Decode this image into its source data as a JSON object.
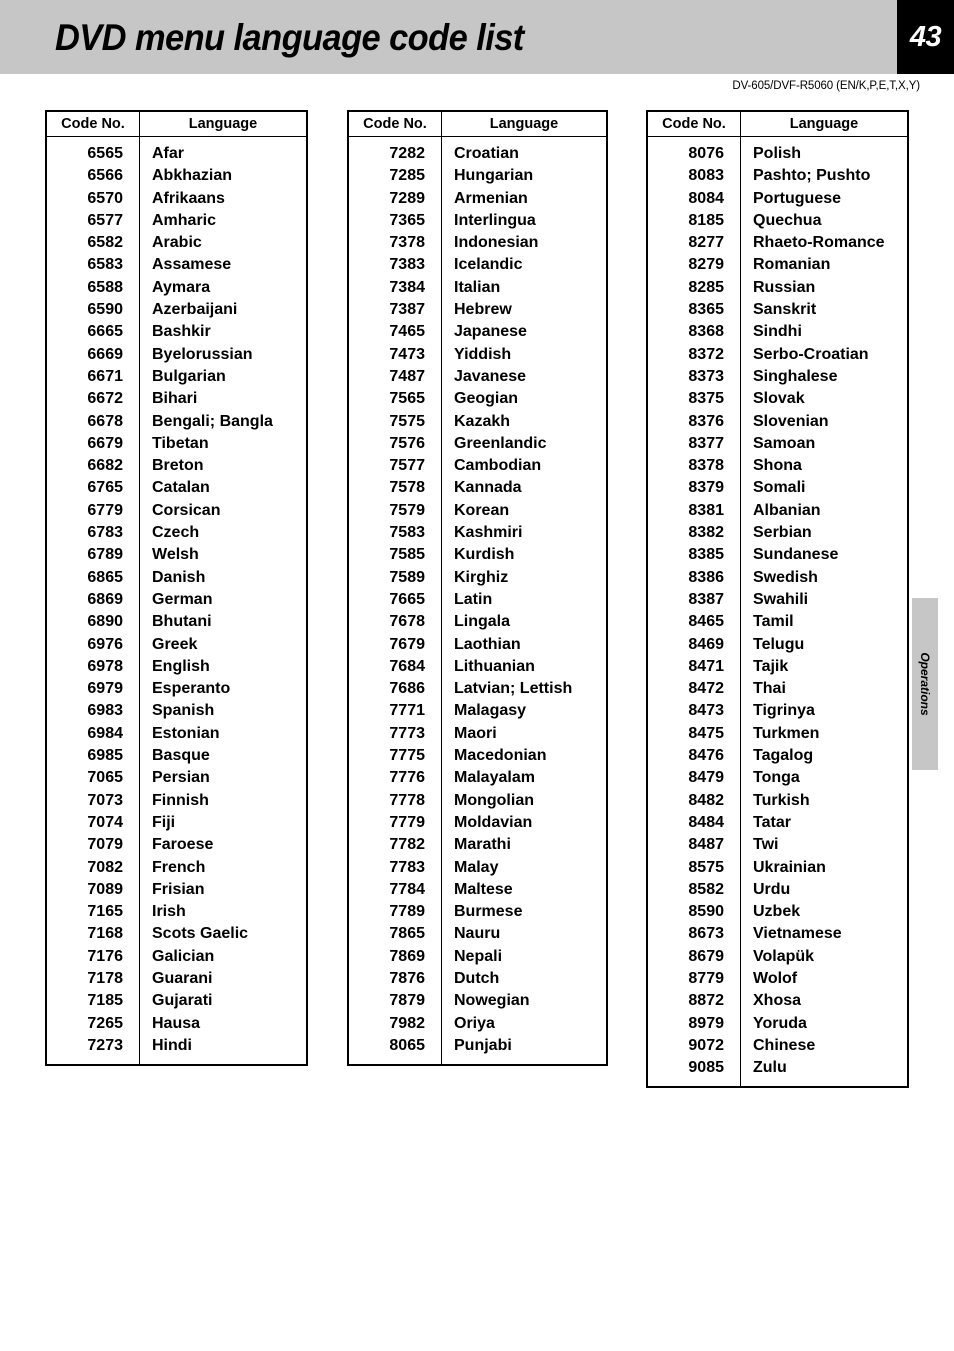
{
  "header": {
    "title": "DVD menu language code list",
    "page_number": "43",
    "model_line": "DV-605/DVF-R5060 (EN/K,P,E,T,X,Y)"
  },
  "side_tab": {
    "label": "Operations"
  },
  "colors": {
    "header_band": "#c6c6c6",
    "page_number_bg": "#000000",
    "page_number_fg": "#ffffff",
    "table_border": "#000000",
    "side_tab_bg": "#c6c6c6"
  },
  "table_columns": [
    "Code No.",
    "Language"
  ],
  "tables": [
    {
      "name": "language-code-table-1",
      "headers": [
        "Code No.",
        "Language"
      ],
      "rows": [
        [
          "6565",
          "Afar"
        ],
        [
          "6566",
          "Abkhazian"
        ],
        [
          "6570",
          "Afrikaans"
        ],
        [
          "6577",
          "Amharic"
        ],
        [
          "6582",
          "Arabic"
        ],
        [
          "6583",
          "Assamese"
        ],
        [
          "6588",
          "Aymara"
        ],
        [
          "6590",
          "Azerbaijani"
        ],
        [
          "6665",
          "Bashkir"
        ],
        [
          "6669",
          "Byelorussian"
        ],
        [
          "6671",
          "Bulgarian"
        ],
        [
          "6672",
          "Bihari"
        ],
        [
          "6678",
          "Bengali; Bangla"
        ],
        [
          "6679",
          "Tibetan"
        ],
        [
          "6682",
          "Breton"
        ],
        [
          "6765",
          "Catalan"
        ],
        [
          "6779",
          "Corsican"
        ],
        [
          "6783",
          "Czech"
        ],
        [
          "6789",
          "Welsh"
        ],
        [
          "6865",
          "Danish"
        ],
        [
          "6869",
          "German"
        ],
        [
          "6890",
          "Bhutani"
        ],
        [
          "6976",
          "Greek"
        ],
        [
          "6978",
          "English"
        ],
        [
          "6979",
          "Esperanto"
        ],
        [
          "6983",
          "Spanish"
        ],
        [
          "6984",
          "Estonian"
        ],
        [
          "6985",
          "Basque"
        ],
        [
          "7065",
          "Persian"
        ],
        [
          "7073",
          "Finnish"
        ],
        [
          "7074",
          "Fiji"
        ],
        [
          "7079",
          "Faroese"
        ],
        [
          "7082",
          "French"
        ],
        [
          "7089",
          "Frisian"
        ],
        [
          "7165",
          "Irish"
        ],
        [
          "7168",
          "Scots Gaelic"
        ],
        [
          "7176",
          "Galician"
        ],
        [
          "7178",
          "Guarani"
        ],
        [
          "7185",
          "Gujarati"
        ],
        [
          "7265",
          "Hausa"
        ],
        [
          "7273",
          "Hindi"
        ]
      ]
    },
    {
      "name": "language-code-table-2",
      "headers": [
        "Code No.",
        "Language"
      ],
      "rows": [
        [
          "7282",
          "Croatian"
        ],
        [
          "7285",
          "Hungarian"
        ],
        [
          "7289",
          "Armenian"
        ],
        [
          "7365",
          "Interlingua"
        ],
        [
          "7378",
          "Indonesian"
        ],
        [
          "7383",
          "Icelandic"
        ],
        [
          "7384",
          "Italian"
        ],
        [
          "7387",
          "Hebrew"
        ],
        [
          "7465",
          "Japanese"
        ],
        [
          "7473",
          "Yiddish"
        ],
        [
          "7487",
          "Javanese"
        ],
        [
          "7565",
          "Geogian"
        ],
        [
          "7575",
          "Kazakh"
        ],
        [
          "7576",
          "Greenlandic"
        ],
        [
          "7577",
          "Cambodian"
        ],
        [
          "7578",
          "Kannada"
        ],
        [
          "7579",
          "Korean"
        ],
        [
          "7583",
          "Kashmiri"
        ],
        [
          "7585",
          "Kurdish"
        ],
        [
          "7589",
          "Kirghiz"
        ],
        [
          "7665",
          "Latin"
        ],
        [
          "7678",
          "Lingala"
        ],
        [
          "7679",
          "Laothian"
        ],
        [
          "7684",
          "Lithuanian"
        ],
        [
          "7686",
          "Latvian; Lettish"
        ],
        [
          "7771",
          "Malagasy"
        ],
        [
          "7773",
          "Maori"
        ],
        [
          "7775",
          "Macedonian"
        ],
        [
          "7776",
          "Malayalam"
        ],
        [
          "7778",
          "Mongolian"
        ],
        [
          "7779",
          "Moldavian"
        ],
        [
          "7782",
          "Marathi"
        ],
        [
          "7783",
          "Malay"
        ],
        [
          "7784",
          "Maltese"
        ],
        [
          "7789",
          "Burmese"
        ],
        [
          "7865",
          "Nauru"
        ],
        [
          "7869",
          "Nepali"
        ],
        [
          "7876",
          "Dutch"
        ],
        [
          "7879",
          "Nowegian"
        ],
        [
          "7982",
          "Oriya"
        ],
        [
          "8065",
          "Punjabi"
        ]
      ]
    },
    {
      "name": "language-code-table-3",
      "headers": [
        "Code No.",
        "Language"
      ],
      "rows": [
        [
          "8076",
          "Polish"
        ],
        [
          "8083",
          "Pashto; Pushto"
        ],
        [
          "8084",
          "Portuguese"
        ],
        [
          "8185",
          "Quechua"
        ],
        [
          "8277",
          "Rhaeto-Romance"
        ],
        [
          "8279",
          "Romanian"
        ],
        [
          "8285",
          "Russian"
        ],
        [
          "8365",
          "Sanskrit"
        ],
        [
          "8368",
          "Sindhi"
        ],
        [
          "8372",
          "Serbo-Croatian"
        ],
        [
          "8373",
          "Singhalese"
        ],
        [
          "8375",
          "Slovak"
        ],
        [
          "8376",
          "Slovenian"
        ],
        [
          "8377",
          "Samoan"
        ],
        [
          "8378",
          "Shona"
        ],
        [
          "8379",
          "Somali"
        ],
        [
          "8381",
          "Albanian"
        ],
        [
          "8382",
          "Serbian"
        ],
        [
          "8385",
          "Sundanese"
        ],
        [
          "8386",
          "Swedish"
        ],
        [
          "8387",
          "Swahili"
        ],
        [
          "8465",
          "Tamil"
        ],
        [
          "8469",
          "Telugu"
        ],
        [
          "8471",
          "Tajik"
        ],
        [
          "8472",
          "Thai"
        ],
        [
          "8473",
          "Tigrinya"
        ],
        [
          "8475",
          "Turkmen"
        ],
        [
          "8476",
          "Tagalog"
        ],
        [
          "8479",
          "Tonga"
        ],
        [
          "8482",
          "Turkish"
        ],
        [
          "8484",
          "Tatar"
        ],
        [
          "8487",
          "Twi"
        ],
        [
          "8575",
          "Ukrainian"
        ],
        [
          "8582",
          "Urdu"
        ],
        [
          "8590",
          "Uzbek"
        ],
        [
          "8673",
          "Vietnamese"
        ],
        [
          "8679",
          "Volapük"
        ],
        [
          "8779",
          "Wolof"
        ],
        [
          "8872",
          "Xhosa"
        ],
        [
          "8979",
          "Yoruda"
        ],
        [
          "9072",
          "Chinese"
        ],
        [
          "9085",
          "Zulu"
        ]
      ]
    }
  ]
}
